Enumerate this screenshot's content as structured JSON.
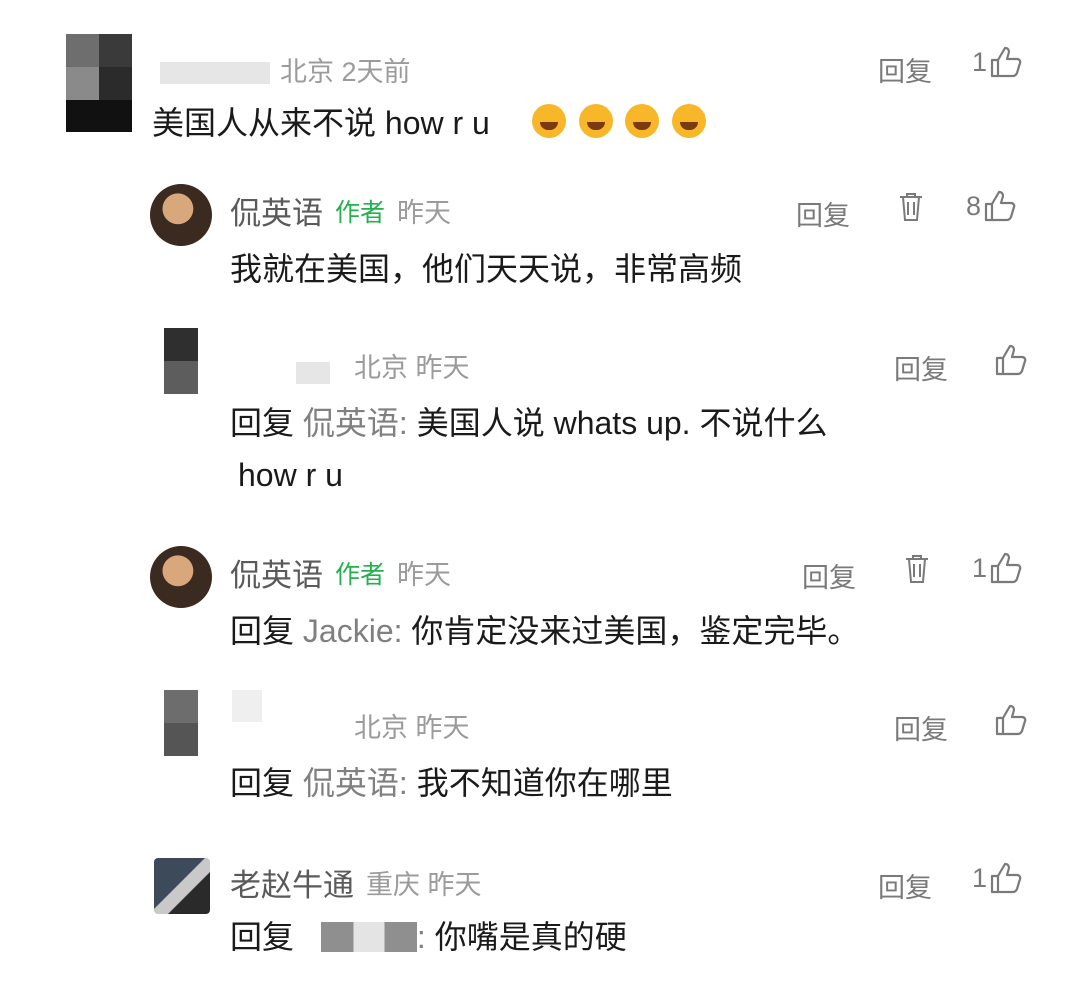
{
  "comments": [
    {
      "meta": "北京 2天前",
      "content": "美国人从来不说 how r u",
      "emojis": [
        "cry-laugh-emoji",
        "grin-emoji",
        "cry-laugh-emoji",
        "grin-emoji"
      ],
      "reply_label": "回复",
      "likes": "1"
    },
    {
      "author": "侃英语",
      "tag": "作者",
      "meta": "昨天",
      "content": "我就在美国，他们天天说，非常高频",
      "reply_label": "回复",
      "likes": "8"
    },
    {
      "meta": "北京 昨天",
      "prefix": "回复",
      "target": "侃英语",
      "content_line1": "美国人说 whats  up. 不说什么",
      "content_line2": "how r u",
      "reply_label": "回复"
    },
    {
      "author": "侃英语",
      "tag": "作者",
      "meta": "昨天",
      "prefix": "回复",
      "target": "Jackie",
      "content": "你肯定没来过美国，鉴定完毕。",
      "reply_label": "回复",
      "likes": "1"
    },
    {
      "meta": "北京 昨天",
      "prefix": "回复",
      "target": "侃英语",
      "content": "我不知道你在哪里",
      "reply_label": "回复"
    },
    {
      "author": "老赵牛通",
      "meta": "重庆 昨天",
      "prefix": "回复",
      "content": "你嘴是真的硬",
      "reply_label": "回复",
      "likes": "1"
    }
  ]
}
